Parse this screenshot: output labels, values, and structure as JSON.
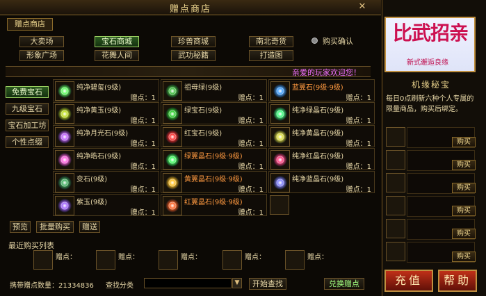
{
  "window": {
    "title": "赠点商店",
    "close": "✕"
  },
  "tab": {
    "label": "赠点商店"
  },
  "categories": [
    {
      "label": "大卖场",
      "active": false
    },
    {
      "label": "宝石商城",
      "active": true
    },
    {
      "label": "珍兽商城",
      "active": false
    },
    {
      "label": "南北奇货",
      "active": false
    },
    {
      "label": "形象广场",
      "active": false
    },
    {
      "label": "花舞人间",
      "active": false
    },
    {
      "label": "武功秘籍",
      "active": false
    },
    {
      "label": "打造图",
      "active": false
    }
  ],
  "confirm": {
    "label": "购买确认"
  },
  "welcome": "亲爱的玩家欢迎您！",
  "side_menu": [
    {
      "label": "免费宝石",
      "active": true
    },
    {
      "label": "九级宝石",
      "active": false
    },
    {
      "label": "宝石加工坊",
      "active": false
    },
    {
      "label": "个性点缀",
      "active": false
    }
  ],
  "price_label": "赠点：1",
  "items": [
    {
      "name": "纯净碧玺(9级)",
      "icon": "gem-green-ring",
      "color": "#e8d8a8",
      "glow": "#60ff60"
    },
    {
      "name": "祖母绿(9级)",
      "icon": "gem-green-bracelet",
      "color": "#e8d8a8",
      "glow": "#40c040"
    },
    {
      "name": "蓝翼石(9级·9级)",
      "icon": "gem-blue-crystal",
      "color": "#ff9a40",
      "glow": "#40a0ff"
    },
    {
      "name": "纯净黄玉(9级)",
      "icon": "gem-yellow-ring",
      "color": "#e8d8a8",
      "glow": "#c0e020"
    },
    {
      "name": "绿宝石(9级)",
      "icon": "gem-green-vine",
      "color": "#e8d8a8",
      "glow": "#30d030"
    },
    {
      "name": "纯净绿晶石(9级)",
      "icon": "gem-green-crystal",
      "color": "#e8d8a8",
      "glow": "#40ff80"
    },
    {
      "name": "纯净月光石(9级)",
      "icon": "gem-purple-moon",
      "color": "#e8d8a8",
      "glow": "#c060ff"
    },
    {
      "name": "红宝石(9级)",
      "icon": "gem-red-ruby",
      "color": "#e8d8a8",
      "glow": "#ff3030"
    },
    {
      "name": "纯净黄晶石(9级)",
      "icon": "gem-yellow-crystal",
      "color": "#e8d8a8",
      "glow": "#e0e040"
    },
    {
      "name": "纯净皓石(9级)",
      "icon": "gem-pink-diamond",
      "color": "#e8d8a8",
      "glow": "#ff60e0"
    },
    {
      "name": "绿翼晶石(9级·9级)",
      "icon": "gem-green-wing",
      "color": "#ff9a40",
      "glow": "#40ff60"
    },
    {
      "name": "纯净红晶石(9级)",
      "icon": "gem-red-crystal",
      "color": "#e8d8a8",
      "glow": "#ff4080"
    },
    {
      "name": "变石(9级)",
      "icon": "gem-green-stone",
      "color": "#e8d8a8",
      "glow": "#40b060"
    },
    {
      "name": "黄翼晶石(9级·9级)",
      "icon": "gem-yellow-wing",
      "color": "#ff9a40",
      "glow": "#ffc020"
    },
    {
      "name": "纯净蓝晶石(9级)",
      "icon": "gem-blue-purple",
      "color": "#e8d8a8",
      "glow": "#8080ff"
    },
    {
      "name": "紫玉(9级)",
      "icon": "gem-purple-jade",
      "color": "#e8d8a8",
      "glow": "#a060ff"
    },
    {
      "name": "红翼晶石(9级·9级)",
      "icon": "gem-red-wing",
      "color": "#ff9a40",
      "glow": "#ff6020"
    }
  ],
  "bottom_buttons": {
    "preview": "预览",
    "bulk_buy": "批量购买",
    "gift": "赠送"
  },
  "recent": {
    "title": "最近购买列表",
    "price_label": "赠点："
  },
  "status": {
    "points_label": "携带赠点数量：21334836",
    "search_label": "查找分类",
    "search_button": "开始查找",
    "exchange_button": "兑换赠点"
  },
  "ad": {
    "title": "比武招亲",
    "subtitle": "新式邂逅良缘"
  },
  "mystery": {
    "title": "机缘秘宝",
    "desc": "每日0点刷新六种个人专属的限量商品，购买后绑定。",
    "buy_label": "购买"
  },
  "actions": {
    "recharge": "充值",
    "help": "帮助"
  }
}
